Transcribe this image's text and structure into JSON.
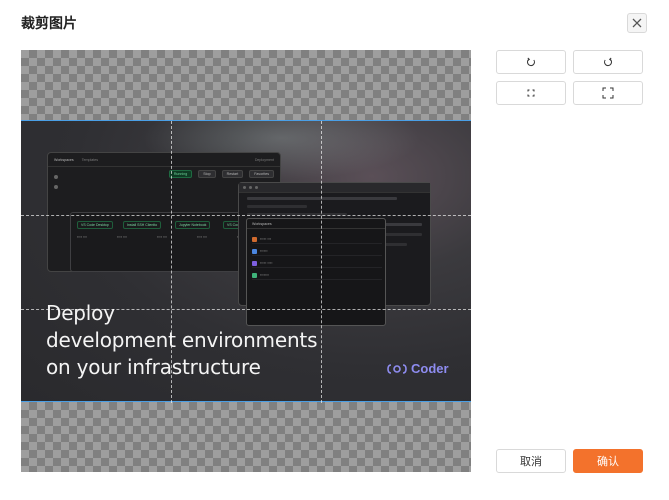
{
  "dialog": {
    "title": "裁剪图片",
    "close_icon": "close-icon"
  },
  "image": {
    "headline_line1": "Deploy",
    "headline_line2": "development environments",
    "headline_line3": "on your infrastructure",
    "logo_text": "Coder",
    "brand_color": "#8e8cf0",
    "mock_ui": {
      "tabs": [
        "Workspaces",
        "Templates",
        "Deployment"
      ],
      "buttons": [
        "Running",
        "Stop",
        "Restart",
        "Favorites"
      ],
      "apps": [
        "VS Code Desktop",
        "Install SSH Clientto",
        "Jupyter Notebook",
        "VS Code Web"
      ],
      "workspaces_title": "Workspaces",
      "share_label": "Browse Screenshots"
    }
  },
  "tools": {
    "rotate_left_icon": "rotate-left-icon",
    "rotate_right_icon": "rotate-right-icon",
    "fit_icon": "fit-icon",
    "expand_icon": "expand-icon"
  },
  "footer": {
    "cancel_label": "取消",
    "confirm_label": "确认",
    "confirm_color": "#f3722c"
  }
}
